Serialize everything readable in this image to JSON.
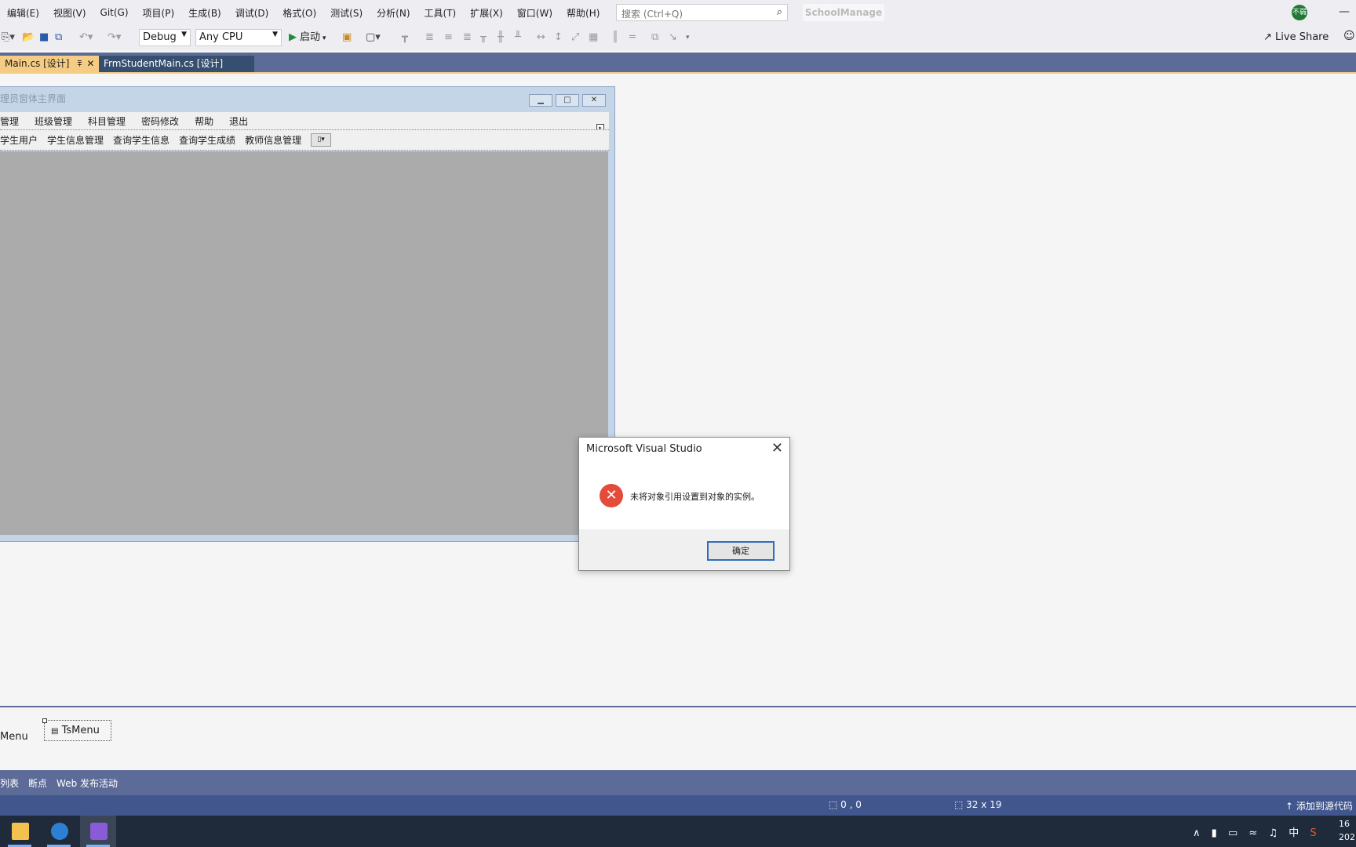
{
  "menubar": {
    "items": [
      "编辑(E)",
      "视图(V)",
      "Git(G)",
      "项目(P)",
      "生成(B)",
      "调试(D)",
      "格式(O)",
      "测试(S)",
      "分析(N)",
      "工具(T)",
      "扩展(X)",
      "窗口(W)",
      "帮助(H)"
    ],
    "search_placeholder": "搜索 (Ctrl+Q)",
    "solution_name": "SchoolManage",
    "avatar_text": "不弱"
  },
  "toolbar": {
    "config": "Debug",
    "platform": "Any CPU",
    "start_label": "启动",
    "live_share_label": "Live Share"
  },
  "tabs": {
    "active": "Main.cs [设计]",
    "inactive": "FrmStudentMain.cs [设计]"
  },
  "form": {
    "title": "理员窗体主界面",
    "menu_items": [
      "管理",
      "班级管理",
      "科目管理",
      "密码修改",
      "帮助",
      "退出"
    ],
    "toolstrip_items": [
      "学生用户",
      "学生信息管理",
      "查询学生信息",
      "查询学生成绩",
      "教师信息管理"
    ]
  },
  "dialog": {
    "title": "Microsoft Visual Studio",
    "message": "未将对象引用设置到对象的实例。",
    "ok_label": "确定"
  },
  "tray": {
    "menu_label": "Menu",
    "tsmenu_label": "TsMenu"
  },
  "bottom_tabs": [
    "列表",
    "断点",
    "Web 发布活动"
  ],
  "status": {
    "position": "0 , 0",
    "size": "32 x 19",
    "source_control": "添加到源代码"
  },
  "clock": {
    "time": "16",
    "date": "202"
  },
  "colors": {
    "accent_tab": "#f5cc84",
    "tabstrip": "#5d6b99",
    "statusbar": "#40568d",
    "error_icon": "#e34b3a"
  }
}
